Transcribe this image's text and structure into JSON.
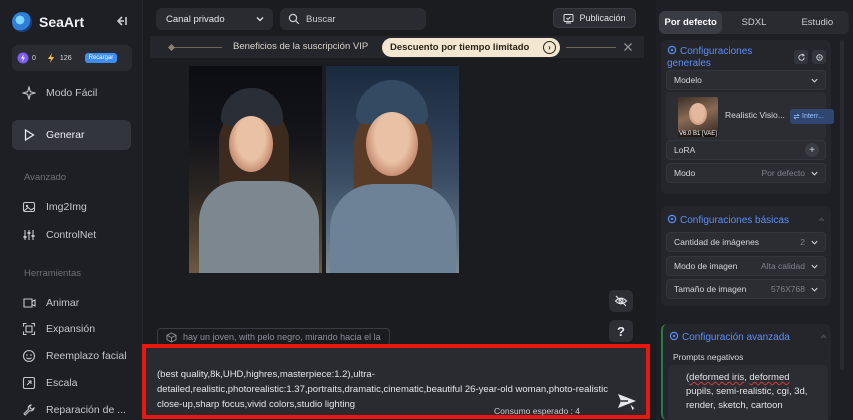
{
  "brand": {
    "name": "SeaArt"
  },
  "credits": {
    "stamina": "0",
    "energy": "126",
    "recharge_label": "Recargar"
  },
  "sidebar": {
    "top_items": [
      {
        "label": "Modo Fácil",
        "icon": "sparkle-icon"
      },
      {
        "label": "Generar",
        "icon": "play-icon",
        "active": true
      }
    ],
    "section_advanced": "Avanzado",
    "advanced_items": [
      {
        "label": "Img2Img",
        "icon": "image-icon"
      },
      {
        "label": "ControlNet",
        "icon": "sliders-icon"
      }
    ],
    "section_tools": "Herramientas",
    "tool_items": [
      {
        "label": "Animar",
        "icon": "animate-icon"
      },
      {
        "label": "Expansión",
        "icon": "expand-icon"
      },
      {
        "label": "Reemplazo facial",
        "icon": "face-icon"
      },
      {
        "label": "Escala",
        "icon": "scale-icon"
      },
      {
        "label": "Reparación de ...",
        "icon": "repair-icon"
      }
    ]
  },
  "topbar": {
    "channel": "Canal privado",
    "search_placeholder": "Buscar",
    "publish_label": "Publicación"
  },
  "vip_banner": {
    "text": "Beneficios de la suscripción VIP",
    "cta": "Descuento por tiempo limitado"
  },
  "prompt_chip": "hay un joven, with pelo negro, mirando hacia el la",
  "prompt": {
    "text": "(best quality,8k,UHD,highres,masterpiece:1.2),ultra-detailed,realistic,photorealistic:1.37,portraits,dramatic,cinematic,beautiful 26-year-old woman,photo-realistic close-up,sharp focus,vivid colors,studio lighting",
    "cost_label": "Consumo esperado : 4"
  },
  "right_panel": {
    "tabs": [
      "Por defecto",
      "SDXL",
      "Estudio"
    ],
    "general": {
      "title": "Configuraciones generales",
      "model_label": "Modelo",
      "model_name": "Realistic Visio...",
      "model_badge": "Interr...",
      "model_thumb_tag": "V6.0 B1 [VAE]",
      "lora_label": "LoRA",
      "mode_label": "Modo",
      "mode_value": "Por defecto"
    },
    "basic": {
      "title": "Configuraciones básicas",
      "rows": [
        {
          "label": "Cantidad de imágenes",
          "value": "2"
        },
        {
          "label": "Modo de imagen",
          "value": "Alta calidad"
        },
        {
          "label": "Tamaño de imagen",
          "value": "576X768"
        }
      ]
    },
    "advanced": {
      "title": "Configuración avanzada",
      "neg_label": "Prompts negativos",
      "neg_text_1": "deformed iris",
      "neg_text_2": ", ",
      "neg_text_3": "deformed",
      "neg_text_4": " pupils, semi-realistic, cgi, 3d, render, sketch, cartoon"
    }
  },
  "colors": {
    "accent": "#5b8ff5",
    "highlight": "#e8180f",
    "vip_pill": "#f3e7d2"
  }
}
